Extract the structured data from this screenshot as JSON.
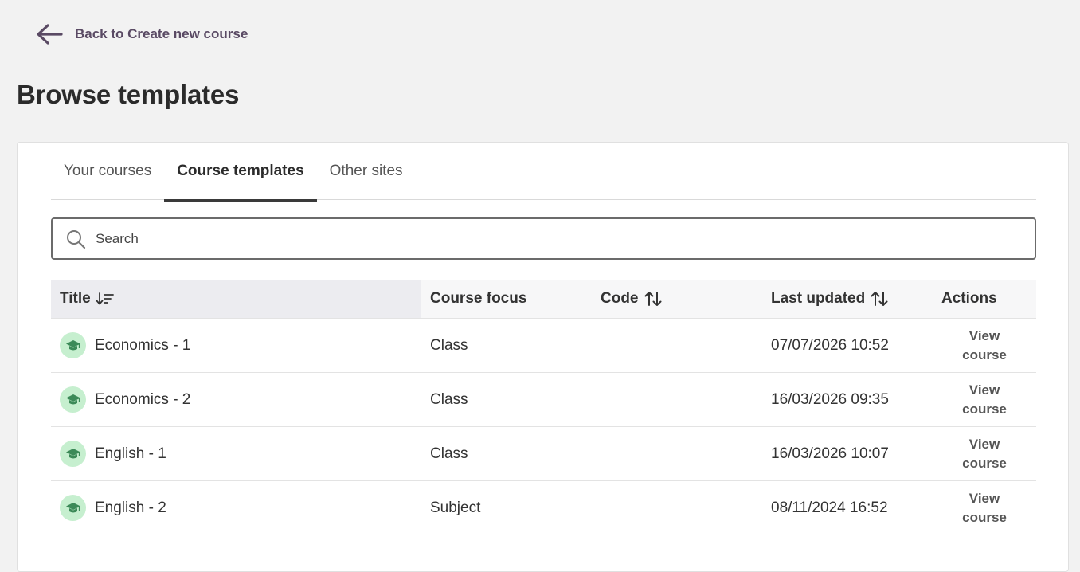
{
  "nav": {
    "back_label": "Back to Create new course",
    "back_icon": "arrow-left-icon"
  },
  "page": {
    "title": "Browse templates"
  },
  "tabs": [
    {
      "label": "Your courses",
      "active": false
    },
    {
      "label": "Course templates",
      "active": true
    },
    {
      "label": "Other sites",
      "active": false
    }
  ],
  "search": {
    "placeholder": "Search",
    "value": ""
  },
  "table": {
    "columns": {
      "title": "Title",
      "focus": "Course focus",
      "code": "Code",
      "updated": "Last updated",
      "actions": "Actions"
    },
    "rows": [
      {
        "title": "Economics - 1",
        "focus": "Class",
        "code": "",
        "updated": "07/07/2026 10:52",
        "action_line1": "View",
        "action_line2": "course"
      },
      {
        "title": "Economics - 2",
        "focus": "Class",
        "code": "",
        "updated": "16/03/2026 09:35",
        "action_line1": "View",
        "action_line2": "course"
      },
      {
        "title": "English - 1",
        "focus": "Class",
        "code": "",
        "updated": "16/03/2026 10:07",
        "action_line1": "View",
        "action_line2": "course"
      },
      {
        "title": "English - 2",
        "focus": "Subject",
        "code": "",
        "updated": "08/11/2024 16:52",
        "action_line1": "View",
        "action_line2": "course"
      }
    ]
  },
  "colors": {
    "accent": "#5a4a64",
    "icon_bg": "#c6efcf",
    "icon_fg": "#3c8a58"
  }
}
